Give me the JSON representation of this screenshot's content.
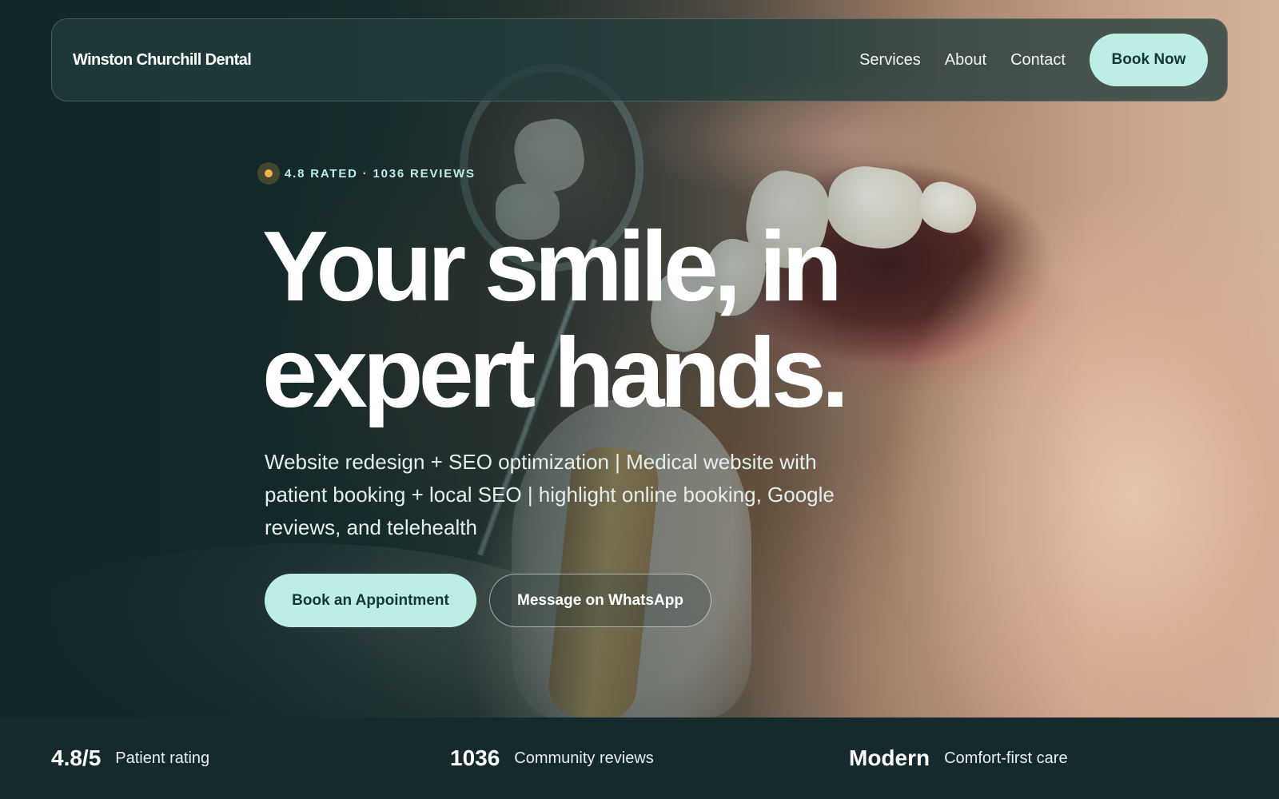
{
  "brand": {
    "name": "Winston Churchill Dental"
  },
  "nav": {
    "links": [
      "Services",
      "About",
      "Contact"
    ],
    "cta_label": "Book Now"
  },
  "hero": {
    "rating_badge": "4.8 RATED · 1036 REVIEWS",
    "headline_line1": "Your smile, in",
    "headline_line2": "expert hands.",
    "subtext": "Website redesign + SEO optimization | Medical website with patient booking + local SEO | highlight online booking, Google reviews, and telehealth",
    "primary_cta": "Book an Appointment",
    "secondary_cta": "Message on WhatsApp"
  },
  "stats": [
    {
      "value": "4.8/5",
      "label": "Patient rating"
    },
    {
      "value": "1036",
      "label": "Community reviews"
    },
    {
      "value": "Modern",
      "label": "Comfort-first care"
    }
  ],
  "colors": {
    "accent": "#bdeee5",
    "dark_teal": "#142a2c",
    "rating_dot": "#f0b04a"
  }
}
